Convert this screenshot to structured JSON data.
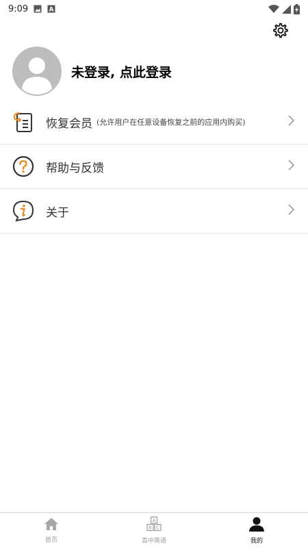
{
  "status_bar": {
    "time": "9:09",
    "left_icons": [
      "image-icon",
      "a-letter-icon"
    ],
    "right_icons": [
      "wifi-icon",
      "signal-icon",
      "battery-charging-icon"
    ]
  },
  "header": {
    "settings_icon": "gear-icon"
  },
  "profile": {
    "login_text": "未登录, 点此登录",
    "avatar_icon": "default-avatar-icon",
    "avatar_color": "#bdbdbd"
  },
  "menu": {
    "items": [
      {
        "label": "恢复会员",
        "sublabel": "(允许用户在任意设备恢复之前的应用内购买)",
        "icon": "restore-list-icon"
      },
      {
        "label": "帮助与反馈",
        "icon": "question-circle-icon"
      },
      {
        "label": "关于",
        "icon": "info-bubble-icon"
      }
    ],
    "chevron_icon": "chevron-right-icon",
    "accent_color": "#e8912d"
  },
  "tab_bar": {
    "tabs": [
      {
        "label": "首页",
        "icon": "home-icon",
        "active": false
      },
      {
        "label": "高中英语",
        "icon": "abc-blocks-icon",
        "active": false
      },
      {
        "label": "我的",
        "icon": "person-icon",
        "active": true
      }
    ]
  }
}
